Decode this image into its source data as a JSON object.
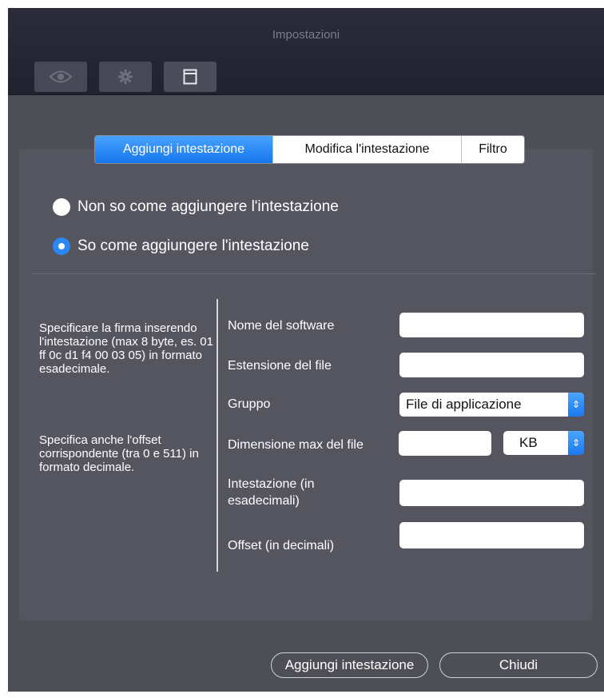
{
  "window": {
    "title": "Impostazioni"
  },
  "toolbar": {
    "buttons": [
      {
        "icon": "eye-icon"
      },
      {
        "icon": "gear-icon"
      },
      {
        "icon": "window-icon"
      }
    ]
  },
  "tabs": [
    {
      "label": "Aggiungi intestazione",
      "active": true
    },
    {
      "label": "Modifica l'intestazione",
      "active": false
    },
    {
      "label": "Filtro",
      "active": false
    }
  ],
  "radios": [
    {
      "label": "Non so come aggiungere l'intestazione",
      "selected": false
    },
    {
      "label": "So come aggiungere l'intestazione",
      "selected": true
    }
  ],
  "help": {
    "paragraph1": "Specificare la firma inserendo l'intestazione (max 8 byte, es. 01 ff 0c d1 f4 00 03 05) in formato esadecimale.",
    "paragraph2": "Specifica anche l'offset corrispondente (tra 0 e 511) in formato decimale."
  },
  "form": {
    "software_name": {
      "label": "Nome del software",
      "value": ""
    },
    "file_extension": {
      "label": "Estensione del file",
      "value": ""
    },
    "group": {
      "label": "Gruppo",
      "selected": "File di applicazione"
    },
    "max_size": {
      "label": "Dimensione max del file",
      "value": "",
      "unit": "KB"
    },
    "header_hex": {
      "label": "Intestazione (in esadecimali)",
      "value": ""
    },
    "offset": {
      "label": "Offset (in decimali)",
      "value": ""
    }
  },
  "buttons": {
    "add": "Aggiungi intestazione",
    "close": "Chiudi"
  },
  "colors": {
    "accent": "#1677ee",
    "window_bg": "#4e4e56",
    "titlebar_bg": "#2b2b3a"
  }
}
